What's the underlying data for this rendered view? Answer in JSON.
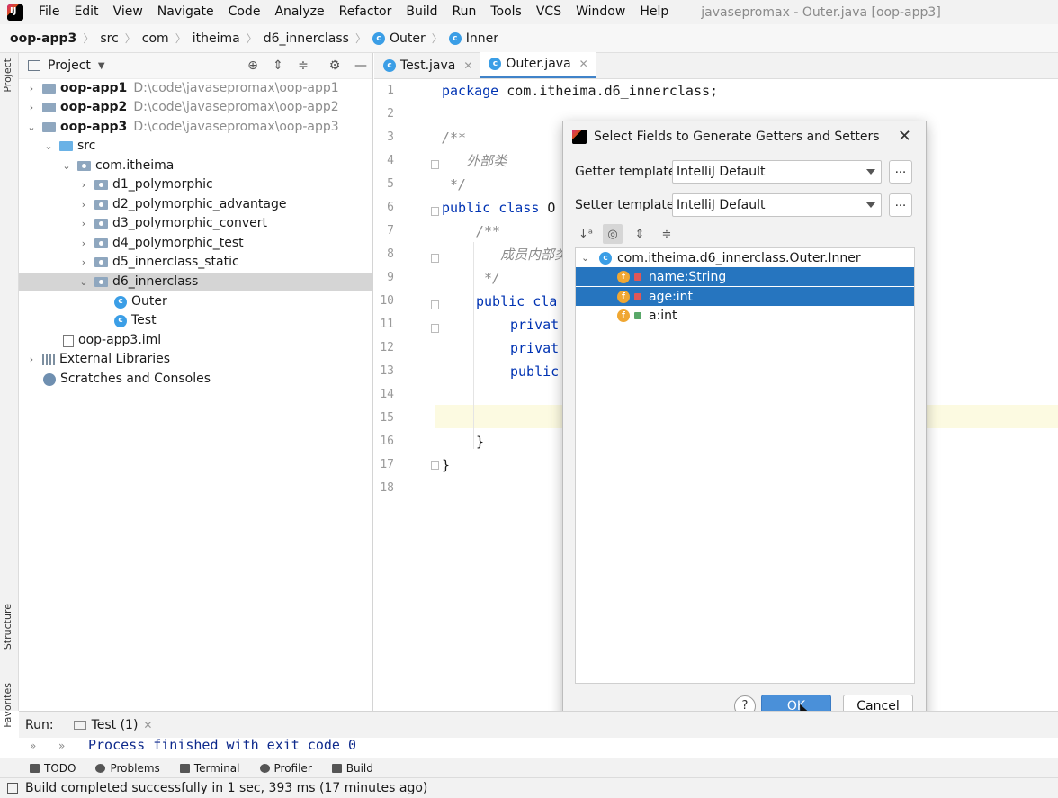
{
  "menubar": {
    "items": [
      "File",
      "Edit",
      "View",
      "Navigate",
      "Code",
      "Analyze",
      "Refactor",
      "Build",
      "Run",
      "Tools",
      "VCS",
      "Window",
      "Help"
    ],
    "window_title": "javasepromax - Outer.java [oop-app3]"
  },
  "breadcrumb": [
    "oop-app3",
    "src",
    "com",
    "itheima",
    "d6_innerclass",
    "Outer",
    "Inner"
  ],
  "sidebar": {
    "stripe_tabs": [
      "Project",
      "Structure",
      "Favorites"
    ]
  },
  "project": {
    "title": "Project",
    "tree": [
      {
        "label": "oop-app1",
        "path": "D:\\code\\javasepromax\\oop-app1"
      },
      {
        "label": "oop-app2",
        "path": "D:\\code\\javasepromax\\oop-app2"
      },
      {
        "label": "oop-app3",
        "path": "D:\\code\\javasepromax\\oop-app3"
      },
      {
        "label": "src"
      },
      {
        "label": "com.itheima"
      },
      {
        "label": "d1_polymorphic"
      },
      {
        "label": "d2_polymorphic_advantage"
      },
      {
        "label": "d3_polymorphic_convert"
      },
      {
        "label": "d4_polymorphic_test"
      },
      {
        "label": "d5_innerclass_static"
      },
      {
        "label": "d6_innerclass"
      },
      {
        "label": "Outer"
      },
      {
        "label": "Test"
      },
      {
        "label": "oop-app3.iml"
      },
      {
        "label": "External Libraries"
      },
      {
        "label": "Scratches and Consoles"
      }
    ]
  },
  "editor": {
    "tabs": [
      "Test.java",
      "Outer.java"
    ],
    "line_numbers": [
      "1",
      "2",
      "3",
      "4",
      "5",
      "6",
      "7",
      "8",
      "9",
      "10",
      "11",
      "12",
      "13",
      "14",
      "15",
      "16",
      "17",
      "18"
    ],
    "code": {
      "l1_kw": "package",
      "l1_rest": " com.itheima.d6_innerclass;",
      "l3": "/**",
      "l4": "   外部类",
      "l5": " */",
      "l6_kw": "public class",
      "l6_rest": " O",
      "l7": "/**",
      "l8": "   成员内部类",
      "l9": " */",
      "l10_kw": "public cla",
      "l11_kw": "privat",
      "l12_kw": "privat",
      "l13_kw": "public",
      "l16": "}",
      "l17": "}"
    }
  },
  "dialog": {
    "title": "Select Fields to Generate Getters and Setters",
    "getter_label": "Getter template:",
    "getter_value": "IntelliJ Default",
    "setter_label": "Setter template:",
    "setter_value": "IntelliJ Default",
    "dots": "...",
    "class_node": "com.itheima.d6_innerclass.Outer.Inner",
    "fields": [
      {
        "label": "name:String",
        "selected": true
      },
      {
        "label": "age:int",
        "selected": true
      },
      {
        "label": "a:int",
        "selected": false
      }
    ],
    "help": "?",
    "ok": "OK",
    "cancel": "Cancel"
  },
  "run": {
    "label": "Run:",
    "tab": "Test (1)",
    "output": "Process finished with exit code 0"
  },
  "tool_windows": [
    "TODO",
    "Problems",
    "Terminal",
    "Profiler",
    "Build"
  ],
  "status": {
    "text": "Build completed successfully in 1 sec, 393 ms (17 minutes ago)"
  },
  "colors": {
    "selection": "#2675bf",
    "keyword": "#0033b3",
    "ok_button": "#4a90d9"
  }
}
